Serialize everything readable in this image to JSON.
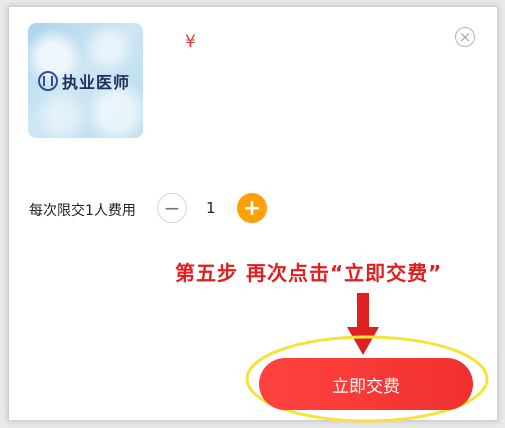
{
  "product": {
    "image_text": "执业医师",
    "price_symbol": "¥"
  },
  "close_icon": "close-icon",
  "quantity": {
    "label": "每次限交1人费用",
    "value": "1",
    "minus_symbol": "−",
    "plus_symbol": "+"
  },
  "annotation": {
    "text": "第五步 再次点击“立即交费”",
    "color": "#e02020",
    "highlight_color": "#f3e33a"
  },
  "pay_button": {
    "label": "立即交费",
    "color": "#f23a38"
  }
}
